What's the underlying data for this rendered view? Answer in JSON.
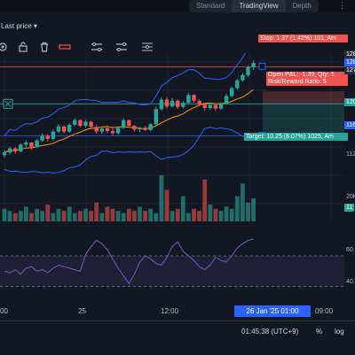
{
  "tabs": [
    "Standard",
    "TradingView",
    "Depth"
  ],
  "active_tab": "TradingView",
  "price_type": "Last price ▾",
  "colors": {
    "up": "#26a69a",
    "down": "#ef5350",
    "bg": "#131722",
    "accent": "#2962ff"
  },
  "toolbar_icons": [
    "settings-icon",
    "unlock-icon",
    "lock-icon",
    "trash-icon",
    "stop-loss-icon",
    "take-profit-icon",
    "position-icon"
  ],
  "price_labels": [
    "128",
    "128",
    "127",
    "120",
    "116",
    "112",
    "20K",
    "11"
  ],
  "position": {
    "stop": "Stop: 1.37 (1.42%) 101, Am",
    "open_pl": "Open P&L: -1.39, Qty: 1",
    "risk_reward": "Risk/Reward Ratio: 5",
    "target": "Target: 10.25 (8.07%) 1025, Am"
  },
  "rsi_levels": [
    "60.",
    "40."
  ],
  "time_labels": [
    "00",
    "25",
    "12:00",
    "09:00"
  ],
  "time_highlight": "26 Jan '25   01:00",
  "clock": "01:45:38 (UTC+9)",
  "percent": "%",
  "log": "log",
  "chart_data": {
    "type": "candlestick",
    "candles": [
      [
        110.5,
        111.5,
        110.0,
        111.0
      ],
      [
        111.0,
        112.2,
        110.6,
        111.8
      ],
      [
        111.8,
        112.0,
        110.8,
        111.2
      ],
      [
        111.2,
        112.8,
        111.0,
        112.5
      ],
      [
        112.5,
        113.3,
        112.0,
        112.9
      ],
      [
        112.9,
        113.0,
        111.6,
        112.0
      ],
      [
        112.0,
        113.6,
        111.9,
        113.3
      ],
      [
        113.3,
        114.6,
        113.0,
        114.2
      ],
      [
        114.2,
        114.5,
        113.1,
        113.6
      ],
      [
        113.6,
        115.4,
        113.3,
        115.0
      ],
      [
        115.0,
        116.4,
        114.7,
        116.0
      ],
      [
        116.0,
        116.2,
        114.6,
        115.0
      ],
      [
        115.0,
        116.6,
        114.8,
        116.3
      ],
      [
        116.3,
        117.6,
        116.0,
        117.2
      ],
      [
        117.2,
        117.3,
        115.8,
        116.1
      ],
      [
        116.1,
        117.2,
        115.8,
        116.9
      ],
      [
        116.9,
        117.1,
        115.6,
        115.9
      ],
      [
        115.9,
        116.3,
        114.6,
        115.0
      ],
      [
        115.0,
        115.9,
        114.5,
        115.6
      ],
      [
        115.6,
        116.2,
        114.7,
        115.1
      ],
      [
        115.1,
        115.7,
        114.3,
        114.7
      ],
      [
        114.7,
        116.0,
        114.4,
        115.7
      ],
      [
        115.7,
        117.6,
        115.5,
        117.2
      ],
      [
        117.2,
        117.3,
        115.8,
        116.1
      ],
      [
        116.1,
        116.3,
        115.0,
        115.4
      ],
      [
        115.4,
        116.0,
        114.9,
        115.7
      ],
      [
        115.7,
        116.1,
        115.1,
        115.3
      ],
      [
        115.3,
        116.6,
        115.1,
        116.4
      ],
      [
        116.4,
        119.8,
        116.2,
        119.3
      ],
      [
        119.3,
        121.6,
        119.0,
        121.1
      ],
      [
        121.1,
        121.6,
        119.4,
        119.8
      ],
      [
        119.8,
        121.4,
        119.6,
        120.9
      ],
      [
        120.9,
        121.2,
        119.3,
        119.7
      ],
      [
        119.7,
        120.8,
        119.4,
        120.5
      ],
      [
        120.5,
        122.4,
        120.2,
        122.0
      ],
      [
        122.0,
        122.1,
        120.5,
        120.9
      ],
      [
        120.9,
        121.2,
        119.8,
        120.2
      ],
      [
        120.2,
        120.5,
        119.1,
        119.5
      ],
      [
        119.5,
        120.5,
        119.2,
        120.1
      ],
      [
        120.1,
        120.3,
        119.0,
        119.4
      ],
      [
        119.4,
        120.6,
        119.2,
        120.3
      ],
      [
        120.3,
        122.2,
        120.1,
        121.8
      ],
      [
        121.8,
        123.6,
        121.5,
        123.3
      ],
      [
        123.3,
        125.1,
        123.0,
        124.8
      ],
      [
        124.8,
        126.2,
        124.5,
        125.8
      ],
      [
        125.8,
        127.6,
        125.4,
        127.3
      ],
      [
        127.3,
        128.6,
        126.8,
        128.1
      ]
    ],
    "volume": [
      6,
      5,
      4,
      5,
      7,
      4,
      6,
      5,
      8,
      4,
      6,
      5,
      7,
      4,
      5,
      6,
      5,
      9,
      4,
      7,
      6,
      5,
      4,
      6,
      5,
      7,
      5,
      6,
      4,
      22,
      15,
      5,
      6,
      12,
      4,
      6,
      5,
      20,
      8,
      6,
      5,
      7,
      6,
      12,
      18,
      9,
      11
    ],
    "rsi": [
      50,
      49,
      51,
      48,
      52,
      53,
      50,
      51,
      49,
      52,
      54,
      53,
      52,
      51,
      50,
      61,
      66,
      70,
      68,
      64,
      58,
      52,
      47,
      42,
      48,
      56,
      60,
      58,
      55,
      54,
      59,
      66,
      69,
      63,
      60,
      57,
      53,
      51,
      54,
      59,
      57,
      56,
      60,
      65,
      68,
      70,
      71
    ],
    "rsi_ylim": [
      30,
      75
    ],
    "ylim": [
      108,
      130
    ]
  }
}
